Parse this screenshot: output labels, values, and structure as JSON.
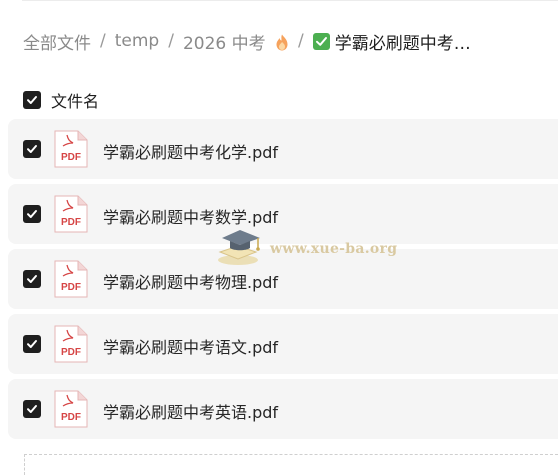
{
  "breadcrumb": {
    "items": [
      "全部文件",
      "temp",
      "2026 中考"
    ],
    "separator": "/",
    "current": "学霸必刷题中考…"
  },
  "header": {
    "label": "文件名"
  },
  "files": [
    {
      "name": "学霸必刷题中考化学.pdf",
      "type": "PDF"
    },
    {
      "name": "学霸必刷题中考数学.pdf",
      "type": "PDF"
    },
    {
      "name": "学霸必刷题中考物理.pdf",
      "type": "PDF"
    },
    {
      "name": "学霸必刷题中考语文.pdf",
      "type": "PDF"
    },
    {
      "name": "学霸必刷题中考英语.pdf",
      "type": "PDF"
    }
  ],
  "watermark": {
    "text": "www.xue-ba.org"
  },
  "colors": {
    "pdf_red": "#d64545",
    "row_bg": "#f5f5f5",
    "checkbox": "#1f1f1f",
    "emoji_green": "#4caf50"
  },
  "icons": {
    "flame": "fire-emoji-icon",
    "current_folder": "check-mark-emoji-icon",
    "file": "pdf-file-icon",
    "checkbox": "checked-checkbox-icon"
  }
}
